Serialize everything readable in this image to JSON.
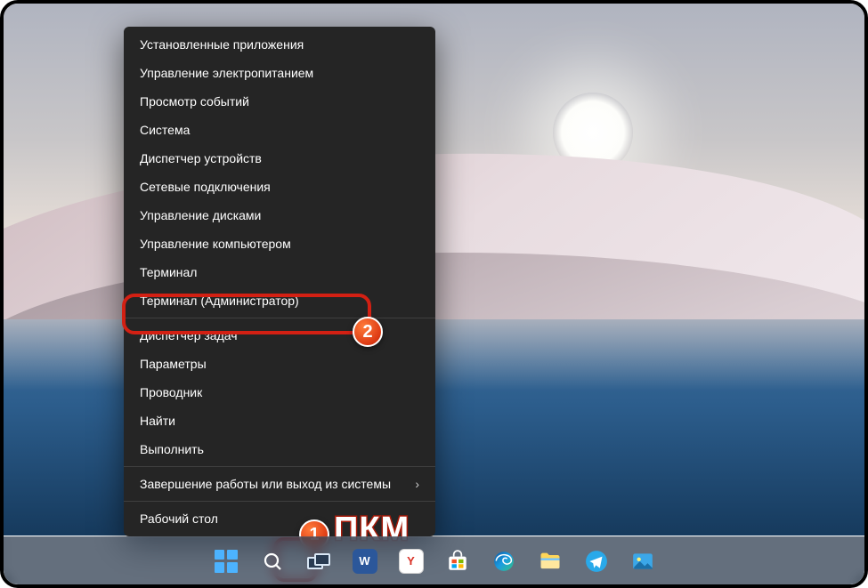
{
  "context_menu": {
    "items": [
      {
        "label": "Установленные приложения"
      },
      {
        "label": "Управление электропитанием"
      },
      {
        "label": "Просмотр событий"
      },
      {
        "label": "Система"
      },
      {
        "label": "Диспетчер устройств"
      },
      {
        "label": "Сетевые подключения"
      },
      {
        "label": "Управление дисками"
      },
      {
        "label": "Управление компьютером"
      },
      {
        "label": "Терминал"
      },
      {
        "label": "Терминал (Администратор)",
        "highlight": true
      }
    ],
    "items2": [
      {
        "label": "Диспетчер задач"
      },
      {
        "label": "Параметры"
      },
      {
        "label": "Проводник"
      },
      {
        "label": "Найти"
      },
      {
        "label": "Выполнить"
      }
    ],
    "items3": [
      {
        "label": "Завершение работы или выход из системы",
        "submenu": true
      }
    ],
    "items4": [
      {
        "label": "Рабочий стол"
      }
    ]
  },
  "taskbar": {
    "icons": [
      {
        "name": "start-button"
      },
      {
        "name": "search-button"
      },
      {
        "name": "taskview-button"
      },
      {
        "name": "word-app",
        "letter": "W",
        "bg": "#2b579a"
      },
      {
        "name": "yandex-app",
        "letter": "Y",
        "bg": "#ffffff",
        "fg": "#d93025"
      },
      {
        "name": "store-app"
      },
      {
        "name": "edge-app"
      },
      {
        "name": "explorer-app"
      },
      {
        "name": "telegram-app"
      },
      {
        "name": "mail-app"
      }
    ]
  },
  "annotations": {
    "badge1": "1",
    "badge2": "2",
    "text": "ПКМ"
  }
}
